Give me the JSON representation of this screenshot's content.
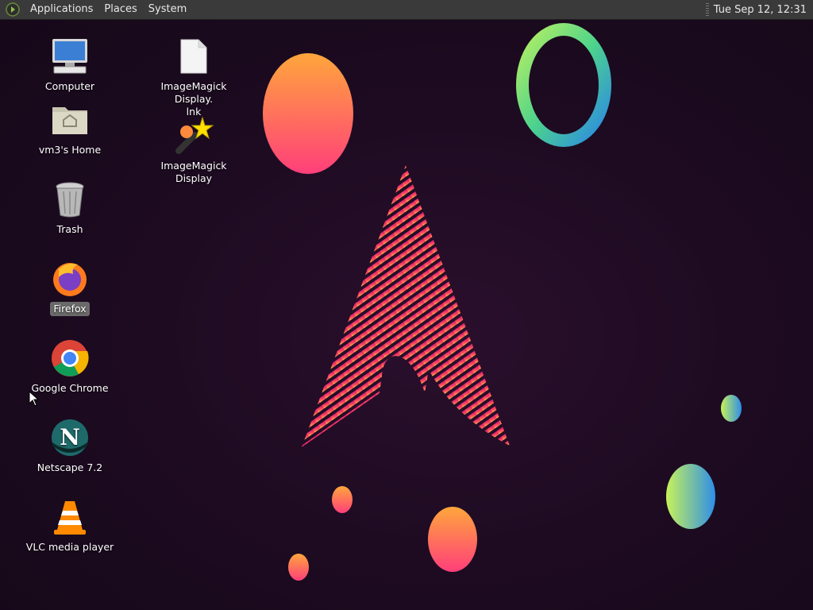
{
  "panel": {
    "menus": [
      "Applications",
      "Places",
      "System"
    ],
    "clock": "Tue Sep 12, 12:31"
  },
  "desktop": {
    "icons": [
      {
        "label": "Computer",
        "icon": "computer-icon"
      },
      {
        "label": "vm3's Home",
        "icon": "home-folder-icon"
      },
      {
        "label": "Trash",
        "icon": "trash-icon"
      },
      {
        "label": "Firefox",
        "icon": "firefox-icon",
        "selected": true
      },
      {
        "label": "Google Chrome",
        "icon": "chrome-icon"
      },
      {
        "label": "Netscape 7.2",
        "icon": "netscape-icon"
      },
      {
        "label": "VLC media player",
        "icon": "vlc-icon"
      },
      {
        "label": "ImageMagick Display.\nlnk",
        "icon": "file-icon"
      },
      {
        "label": "ImageMagick Display",
        "icon": "imagemagick-icon"
      }
    ]
  },
  "colors": {
    "panel_bg": "#3a3a3a",
    "wallpaper_bg": "#1e0b22",
    "accent_pink": "#e91e63",
    "accent_orange": "#ff9e3d"
  }
}
